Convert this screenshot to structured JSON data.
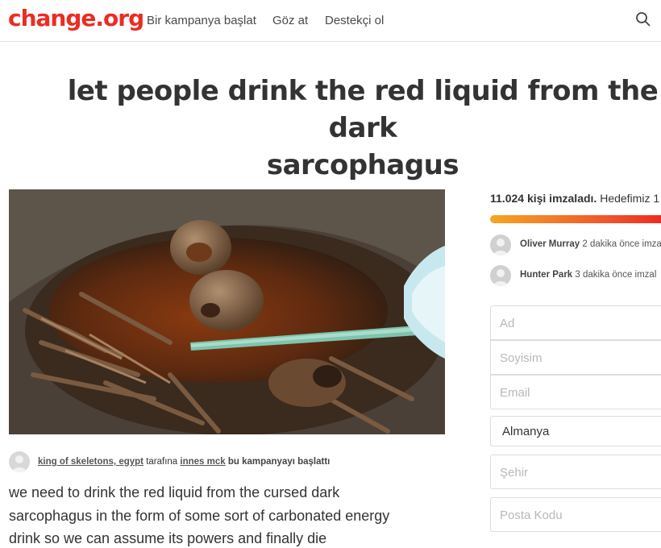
{
  "header": {
    "logo": "change.org",
    "nav": [
      "Bir kampanya başlat",
      "Göz at",
      "Destekçi ol"
    ],
    "search_icon": "search-icon"
  },
  "petition": {
    "title_line1": "let people drink the red liquid from the dark",
    "title_line2": "sarcophagus",
    "starter": {
      "target": "king of skeletons, egypt",
      "between": " tarafına ",
      "author": "innes mck",
      "suffix": " bu kampanyayı başlattı"
    },
    "body_lines": [
      "we need to drink the red liquid from the cursed dark",
      "sarcophagus in the form of some sort of carbonated energy",
      "drink so we can assume its powers and finally die"
    ]
  },
  "sidebar": {
    "signed_count": "11.024 kişi imzaladı.",
    "goal_text": " Hedefimiz 1",
    "progress_fraction": 1.0,
    "recent_signers": [
      {
        "name": "Oliver Murray",
        "time": " 2 dakika önce imza"
      },
      {
        "name": "Hunter Park",
        "time": " 3 dakika önce imzal"
      }
    ],
    "form": {
      "first_name_placeholder": "Ad",
      "last_name_placeholder": "Soyisim",
      "email_placeholder": "Email",
      "country_value": "Almanya",
      "city_placeholder": "Şehir",
      "zip_placeholder": "Posta Kodu"
    }
  },
  "colors": {
    "brand": "#ec2c22",
    "progress_start": "#f6a623",
    "progress_end": "#ec2c22"
  }
}
